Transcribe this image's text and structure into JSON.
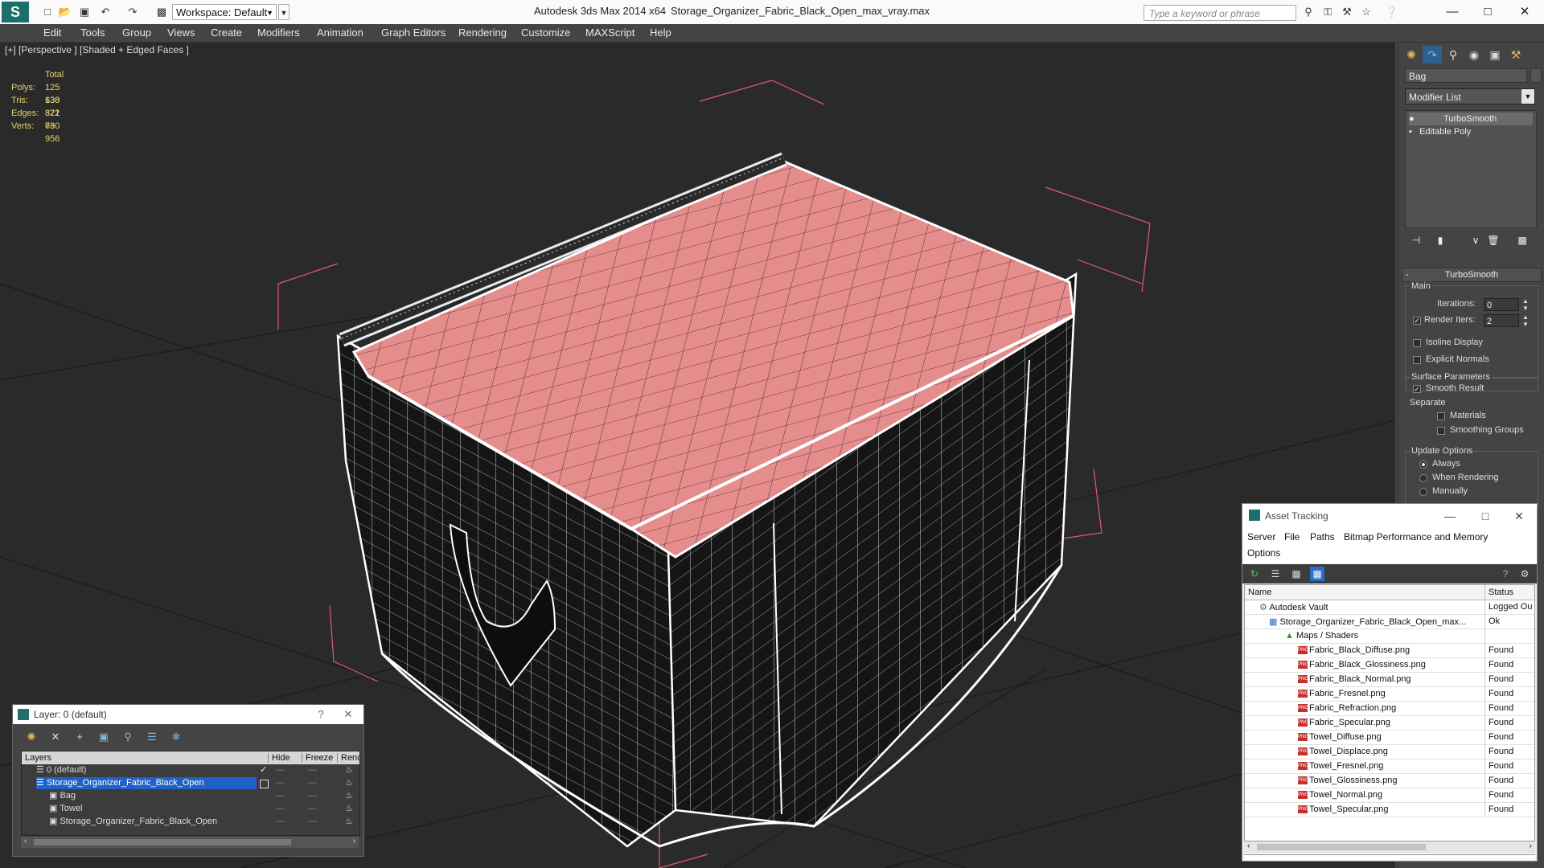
{
  "titlebar": {
    "workspace": "Workspace: Default",
    "app_title": "Autodesk 3ds Max  2014 x64",
    "file_title": "Storage_Organizer_Fabric_Black_Open_max_vray.max",
    "search_placeholder": "Type a keyword or phrase"
  },
  "menu": [
    "Edit",
    "Tools",
    "Group",
    "Views",
    "Create",
    "Modifiers",
    "Animation",
    "Graph Editors",
    "Rendering",
    "Customize",
    "MAXScript",
    "Help"
  ],
  "viewport": {
    "label": "[+] [Perspective ] [Shaded + Edged Faces ]",
    "stats": {
      "header": "Total",
      "polys_label": "Polys:",
      "polys": "125 638",
      "tris_label": "Tris:",
      "tris": "130 822",
      "edges_label": "Edges:",
      "edges": "371 730",
      "verts_label": "Verts:",
      "verts": "69 956"
    },
    "lid_color": "#e58c8c",
    "body_color": "#151515"
  },
  "command_panel": {
    "object_name": "Bag",
    "modifier_list": "Modifier List",
    "stack": [
      "TurboSmooth",
      "Editable Poly"
    ],
    "rollout": "TurboSmooth",
    "main_label": "Main",
    "iterations_label": "Iterations:",
    "iterations": "0",
    "render_iters_label": "Render Iters:",
    "render_iters": "2",
    "isoline": "Isoline Display",
    "explicit_normals": "Explicit Normals",
    "surface_params": "Surface Parameters",
    "smooth_result": "Smooth Result",
    "separate": "Separate",
    "materials": "Materials",
    "smoothing_groups": "Smoothing Groups",
    "update_options": "Update Options",
    "always": "Always",
    "when_rendering": "When Rendering",
    "manually": "Manually"
  },
  "asset_tracking": {
    "title": "Asset Tracking",
    "menus": [
      "Server",
      "File",
      "Paths",
      "Bitmap Performance and Memory",
      "Options"
    ],
    "col_name": "Name",
    "col_status": "Status",
    "rows": [
      {
        "name": "Autodesk Vault",
        "status": "Logged Ou"
      },
      {
        "name": "Storage_Organizer_Fabric_Black_Open_max...",
        "status": "Ok"
      },
      {
        "name": "Maps / Shaders",
        "status": ""
      },
      {
        "name": "Fabric_Black_Diffuse.png",
        "status": "Found"
      },
      {
        "name": "Fabric_Black_Glossiness.png",
        "status": "Found"
      },
      {
        "name": "Fabric_Black_Normal.png",
        "status": "Found"
      },
      {
        "name": "Fabric_Fresnel.png",
        "status": "Found"
      },
      {
        "name": "Fabric_Refraction.png",
        "status": "Found"
      },
      {
        "name": "Fabric_Specular.png",
        "status": "Found"
      },
      {
        "name": "Towel_Diffuse.png",
        "status": "Found"
      },
      {
        "name": "Towel_Displace.png",
        "status": "Found"
      },
      {
        "name": "Towel_Fresnel.png",
        "status": "Found"
      },
      {
        "name": "Towel_Glossiness.png",
        "status": "Found"
      },
      {
        "name": "Towel_Normal.png",
        "status": "Found"
      },
      {
        "name": "Towel_Specular.png",
        "status": "Found"
      }
    ],
    "png_badge": "PNG"
  },
  "layer_dialog": {
    "title": "Layer: 0 (default)",
    "help": "?",
    "col_layers": "Layers",
    "col_hide": "Hide",
    "col_freeze": "Freeze",
    "col_render": "Render",
    "rows": [
      "0 (default)",
      "Storage_Organizer_Fabric_Black_Open",
      "Bag",
      "Towel",
      "Storage_Organizer_Fabric_Black_Open"
    ],
    "dash": "—"
  }
}
